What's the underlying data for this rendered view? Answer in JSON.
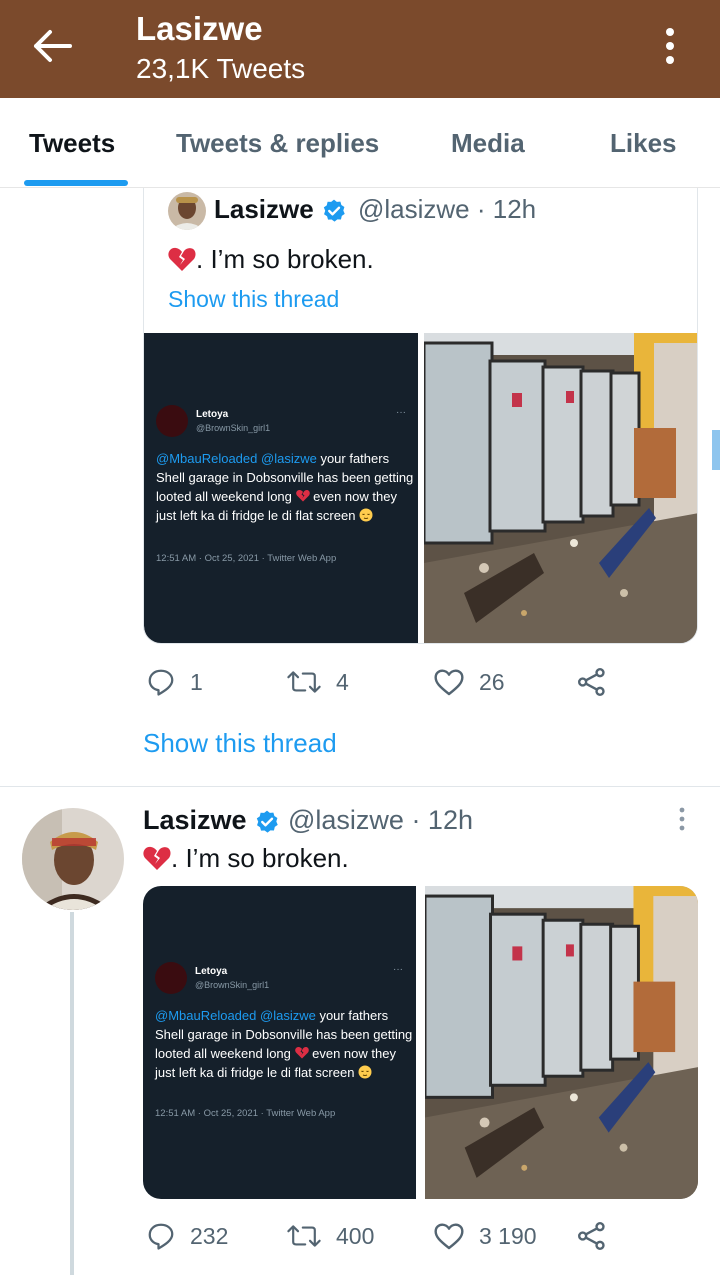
{
  "header": {
    "back_icon": "arrow-left-icon",
    "title": "Lasizwe",
    "subtitle": "23,1K Tweets",
    "more_icon": "more-vertical-icon",
    "background": "#7b4a2c"
  },
  "tabs": [
    {
      "label": "Tweets",
      "active": true
    },
    {
      "label": "Tweets & replies",
      "active": false
    },
    {
      "label": "Media",
      "active": false
    },
    {
      "label": "Likes",
      "active": false
    }
  ],
  "accent": "#1d9bf0",
  "quoted_tweet": {
    "name": "Lasizwe",
    "handle_time": "@lasizwe · 12h",
    "text": ". I’m so broken.",
    "text_icon": "broken-heart-icon",
    "show_thread": "Show this thread",
    "counts": {
      "replies": "1",
      "retweets": "4",
      "likes": "26"
    }
  },
  "show_thread": "Show this thread",
  "tweet": {
    "name": "Lasizwe",
    "handle_time": "@lasizwe · 12h",
    "text": ". I’m so broken.",
    "text_icon": "broken-heart-icon",
    "counts": {
      "replies": "232",
      "retweets": "400",
      "likes": "3 190"
    }
  },
  "embedded_screenshot": {
    "name": "Letoya",
    "handle": "@BrownSkin_girl1",
    "mention1": "@MbauReloaded",
    "mention2": "@lasizwe",
    "body_1": " your fathers Shell garage in Dobsonville has been getting looted all weekend long",
    "body_2": " even now they just left ka di fridge le di flat screen",
    "footer": "12:51 AM · Oct 25, 2021 · Twitter Web App"
  }
}
